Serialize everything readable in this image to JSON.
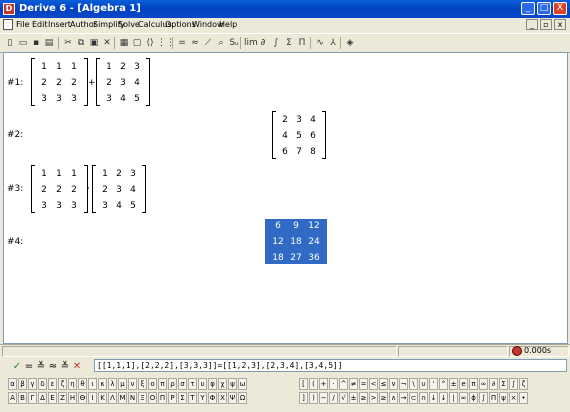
{
  "window": {
    "title": "Derive 6 - [Algebra 1]",
    "min": "_",
    "max": "□",
    "close": "X"
  },
  "menu": [
    "File",
    "Edit",
    "Insert",
    "Author",
    "Simplify",
    "Solve",
    "Calculus",
    "Options",
    "Window",
    "Help"
  ],
  "mdi": {
    "min": "_",
    "restore": "▫",
    "close": "x"
  },
  "toolbar_icons": [
    {
      "name": "new-icon",
      "glyph": "▯"
    },
    {
      "name": "open-icon",
      "glyph": "▭"
    },
    {
      "name": "save-icon",
      "glyph": "▪"
    },
    {
      "name": "print-icon",
      "glyph": "▤"
    },
    {
      "name": "cut-icon",
      "glyph": "✂"
    },
    {
      "name": "copy-icon",
      "glyph": "⧉"
    },
    {
      "name": "paste-icon",
      "glyph": "▣"
    },
    {
      "name": "delete-icon",
      "glyph": "✕"
    },
    {
      "name": "insert-text-icon",
      "glyph": "▦"
    },
    {
      "name": "insert-box-icon",
      "glyph": "▢"
    },
    {
      "name": "vector-icon",
      "glyph": "⟨⟩"
    },
    {
      "name": "matrix-icon",
      "glyph": "⋮⋮"
    },
    {
      "name": "simplify-icon",
      "glyph": "="
    },
    {
      "name": "approximate-icon",
      "glyph": "≈"
    },
    {
      "name": "plot-icon",
      "glyph": "⟋"
    },
    {
      "name": "zoom-icon",
      "glyph": "⌕"
    },
    {
      "name": "substitute-icon",
      "glyph": "Sᵤ"
    },
    {
      "name": "limit-icon",
      "glyph": "lim"
    },
    {
      "name": "derivative-icon",
      "glyph": "∂"
    },
    {
      "name": "integral-icon",
      "glyph": "∫"
    },
    {
      "name": "sum-icon",
      "glyph": "Σ"
    },
    {
      "name": "product-icon",
      "glyph": "Π"
    },
    {
      "name": "graph-2d-icon",
      "glyph": "∿"
    },
    {
      "name": "graph-3d-icon",
      "glyph": "⅄"
    },
    {
      "name": "help-icon",
      "glyph": "◈"
    }
  ],
  "expressions": [
    {
      "label": "#1:",
      "left": [
        [
          "1",
          "1",
          "1"
        ],
        [
          "2",
          "2",
          "2"
        ],
        [
          "3",
          "3",
          "3"
        ]
      ],
      "op": "+",
      "right": [
        [
          "1",
          "2",
          "3"
        ],
        [
          "2",
          "3",
          "4"
        ],
        [
          "3",
          "4",
          "5"
        ]
      ]
    },
    {
      "label": "#2:",
      "result": [
        [
          "2",
          "3",
          "4"
        ],
        [
          "4",
          "5",
          "6"
        ],
        [
          "6",
          "7",
          "8"
        ]
      ]
    },
    {
      "label": "#3:",
      "left": [
        [
          "1",
          "1",
          "1"
        ],
        [
          "2",
          "2",
          "2"
        ],
        [
          "3",
          "3",
          "3"
        ]
      ],
      "op": "·",
      "right": [
        [
          "1",
          "2",
          "3"
        ],
        [
          "2",
          "3",
          "4"
        ],
        [
          "3",
          "4",
          "5"
        ]
      ]
    },
    {
      "label": "#4:",
      "result": [
        [
          "6",
          "9",
          "12"
        ],
        [
          "12",
          "18",
          "24"
        ],
        [
          "18",
          "27",
          "36"
        ]
      ]
    }
  ],
  "status": {
    "timer": "0.000s"
  },
  "entry": {
    "value": "[[1,1,1],[2,2,2],[3,3,3]]=[[1,2,3],[2,3,4],[3,4,5]]",
    "icons": [
      {
        "name": "enter-icon",
        "glyph": "✓"
      },
      {
        "name": "simplify-entry-icon",
        "glyph": "="
      },
      {
        "name": "author-simplify-icon",
        "glyph": "≚"
      },
      {
        "name": "approx-entry-icon",
        "glyph": "≈"
      },
      {
        "name": "author-approx-icon",
        "glyph": "≚"
      },
      {
        "name": "cancel-icon",
        "glyph": "✕"
      }
    ]
  },
  "greek_lower": [
    "α",
    "β",
    "γ",
    "δ",
    "ε",
    "ζ",
    "η",
    "θ",
    "ι",
    "κ",
    "λ",
    "μ",
    "ν",
    "ξ",
    "ο",
    "π",
    "ρ",
    "σ",
    "τ",
    "υ",
    "φ",
    "χ",
    "ψ",
    "ω"
  ],
  "greek_upper": [
    "Α",
    "Β",
    "Γ",
    "Δ",
    "Ε",
    "Ζ",
    "Η",
    "Θ",
    "Ι",
    "Κ",
    "Λ",
    "Μ",
    "Ν",
    "Ξ",
    "Ο",
    "Π",
    "Ρ",
    "Σ",
    "Τ",
    "Υ",
    "Φ",
    "Χ",
    "Ψ",
    "Ω"
  ],
  "math_row1": [
    "[",
    "(",
    "+",
    "·",
    "^",
    "≠",
    "=",
    "<",
    "≤",
    "∨",
    "¬",
    "\\",
    "∪",
    "'",
    "°",
    "±",
    "e",
    "π",
    "∞",
    "∂",
    "Σ",
    "∫",
    "ζ"
  ],
  "math_row2": [
    "]",
    ")",
    "−",
    "/",
    "√",
    "±",
    "≥",
    ">",
    "≥",
    "∧",
    "→",
    "⊂",
    "∩",
    "↓",
    "↓",
    "|",
    "∞",
    "ɸ",
    "∫",
    "Π",
    "ψ",
    "×",
    "•"
  ]
}
